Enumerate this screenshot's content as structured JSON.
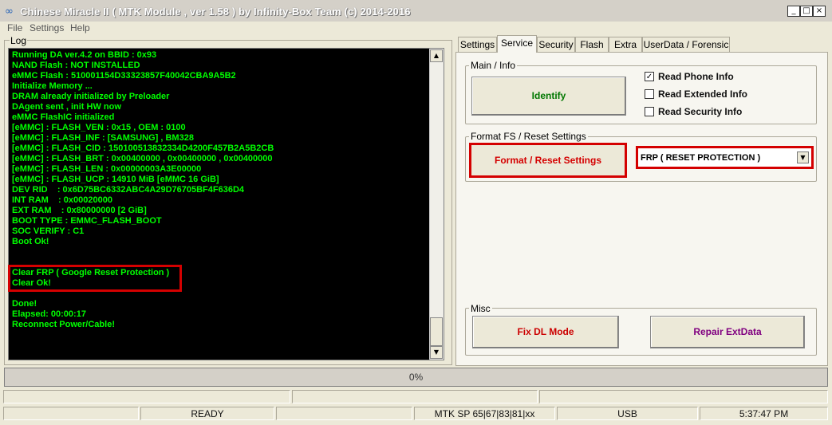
{
  "window": {
    "title": "Chinese Miracle II ( MTK Module , ver 1.58 ) by Infinity-Box Team (c) 2014-2016",
    "controls": {
      "minimize": "_",
      "maximize": "□",
      "close": "×"
    }
  },
  "menu": {
    "file": "File",
    "settings": "Settings",
    "help": "Help"
  },
  "log": {
    "label": "Log",
    "lines": [
      "Running DA ver.4.2 on BBID : 0x93",
      "NAND Flash : NOT INSTALLED",
      "eMMC Flash : 510001154D33323857F40042CBA9A5B2",
      "Initialize Memory ...",
      "DRAM already initialized by Preloader",
      "DAgent sent , init HW now",
      "eMMC FlashIC initialized",
      "[eMMC] : FLASH_VEN : 0x15 , OEM : 0100",
      "[eMMC] : FLASH_INF : [SAMSUNG] , BM328",
      "[eMMC] : FLASH_CID : 150100513832334D4200F457B2A5B2CB",
      "[eMMC] : FLASH_BRT : 0x00400000 , 0x00400000 , 0x00400000",
      "[eMMC] : FLASH_LEN : 0x00000003A3E00000",
      "[eMMC] : FLASH_UCP : 14910 MiB [eMMC 16 GiB]",
      "DEV RID    : 0x6D75BC6332ABC4A29D76705BF4F636D4",
      "INT RAM    : 0x00020000",
      "EXT RAM    : 0x80000000 [2 GiB]",
      "BOOT TYPE : EMMC_FLASH_BOOT",
      "SOC VERIFY : C1",
      "Boot Ok!",
      "",
      "",
      "Clear FRP ( Google Reset Protection )",
      "Clear Ok!",
      "",
      "Done!",
      "Elapsed: 00:00:17",
      "Reconnect Power/Cable!"
    ]
  },
  "tabs": [
    "Settings",
    "Service",
    "Security",
    "Flash",
    "Extra",
    "UserData / Forensic"
  ],
  "service": {
    "main_info_label": "Main / Info",
    "identify_label": "Identify",
    "checkboxes": [
      {
        "label": "Read Phone Info",
        "checked": true,
        "mark": "✓"
      },
      {
        "label": "Read Extended Info",
        "checked": false,
        "mark": ""
      },
      {
        "label": "Read Security Info",
        "checked": false,
        "mark": ""
      }
    ],
    "format_label": "Format FS / Reset Settings",
    "format_button": "Format / Reset Settings",
    "format_option": "FRP ( RESET PROTECTION )",
    "misc_label": "Misc",
    "fixdl_button": "Fix DL Mode",
    "repair_button": "Repair ExtData"
  },
  "progress": {
    "text": "0%",
    "value": 0
  },
  "status": {
    "state": "READY",
    "chipset": "MTK SP 65|67|83|81|xx",
    "connection": "USB",
    "time": "5:37:47 PM"
  }
}
